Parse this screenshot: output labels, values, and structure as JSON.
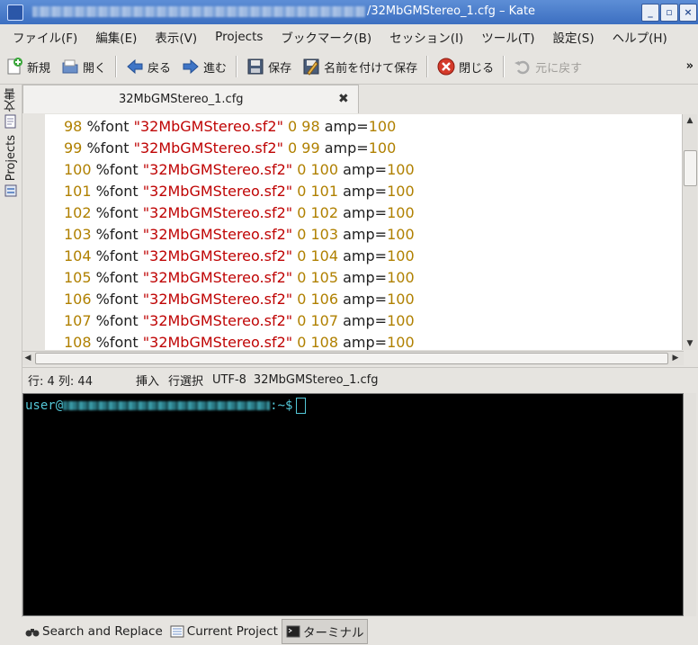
{
  "window": {
    "title": "/32MbGMStereo_1.cfg – Kate",
    "buttons": [
      "_",
      "▫",
      "×"
    ]
  },
  "menu": [
    "ファイル(F)",
    "編集(E)",
    "表示(V)",
    "Projects",
    "ブックマーク(B)",
    "セッション(I)",
    "ツール(T)",
    "設定(S)",
    "ヘルプ(H)"
  ],
  "toolbar": {
    "new": "新規",
    "open": "開く",
    "back": "戻る",
    "forward": "進む",
    "save": "保存",
    "save_as": "名前を付けて保存",
    "close": "閉じる",
    "undo": "元に戻す",
    "more": "»"
  },
  "side_tabs": {
    "documents": "文書",
    "projects": "Projects"
  },
  "tab": {
    "filename": "32MbGMStereo_1.cfg",
    "close": "✖"
  },
  "editor": {
    "lines": [
      {
        "n": "98",
        "kw": "%font",
        "str": "\"32MbGMStereo.sf2\"",
        "a": "0",
        "b": "98",
        "amp": "amp=",
        "v": "100"
      },
      {
        "n": "99",
        "kw": "%font",
        "str": "\"32MbGMStereo.sf2\"",
        "a": "0",
        "b": "99",
        "amp": "amp=",
        "v": "100"
      },
      {
        "n": "100",
        "kw": "%font",
        "str": "\"32MbGMStereo.sf2\"",
        "a": "0",
        "b": "100",
        "amp": "amp=",
        "v": "100"
      },
      {
        "n": "101",
        "kw": "%font",
        "str": "\"32MbGMStereo.sf2\"",
        "a": "0",
        "b": "101",
        "amp": "amp=",
        "v": "100"
      },
      {
        "n": "102",
        "kw": "%font",
        "str": "\"32MbGMStereo.sf2\"",
        "a": "0",
        "b": "102",
        "amp": "amp=",
        "v": "100"
      },
      {
        "n": "103",
        "kw": "%font",
        "str": "\"32MbGMStereo.sf2\"",
        "a": "0",
        "b": "103",
        "amp": "amp=",
        "v": "100"
      },
      {
        "n": "104",
        "kw": "%font",
        "str": "\"32MbGMStereo.sf2\"",
        "a": "0",
        "b": "104",
        "amp": "amp=",
        "v": "100"
      },
      {
        "n": "105",
        "kw": "%font",
        "str": "\"32MbGMStereo.sf2\"",
        "a": "0",
        "b": "105",
        "amp": "amp=",
        "v": "100"
      },
      {
        "n": "106",
        "kw": "%font",
        "str": "\"32MbGMStereo.sf2\"",
        "a": "0",
        "b": "106",
        "amp": "amp=",
        "v": "100"
      },
      {
        "n": "107",
        "kw": "%font",
        "str": "\"32MbGMStereo.sf2\"",
        "a": "0",
        "b": "107",
        "amp": "amp=",
        "v": "100"
      },
      {
        "n": "108",
        "kw": "%font",
        "str": "\"32MbGMStereo.sf2\"",
        "a": "0",
        "b": "108",
        "amp": "amp=",
        "v": "100"
      }
    ]
  },
  "status": {
    "position": "行: 4 列: 44",
    "mode": "挿入",
    "selection": "行選択",
    "encoding": "UTF-8",
    "filename": "32MbGMStereo_1.cfg"
  },
  "terminal": {
    "user": "user@",
    "suffix": ":~$"
  },
  "bottom_tabs": [
    "Search and Replace",
    "Current Project",
    "ターミナル"
  ],
  "colors": {
    "number": "#b08000",
    "string": "#bf0303",
    "terminal_prompt": "#54c8d8",
    "titlebar": "#3c6fc1"
  }
}
